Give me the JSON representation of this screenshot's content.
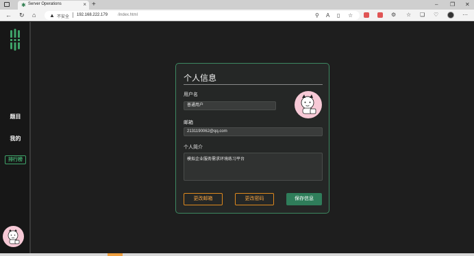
{
  "browser": {
    "tab_title": "Server Operations",
    "url_warning": "不安全",
    "url_host": "192.168.222.179",
    "url_path": "/index.html"
  },
  "sidebar": {
    "items": [
      {
        "label": "题目"
      },
      {
        "label": "我的"
      },
      {
        "label": "排行榜"
      }
    ]
  },
  "profile": {
    "title": "个人信息",
    "username_label": "用户名",
    "username_value": "普通用户",
    "email_label": "邮箱",
    "email_value": "2131190062@qq.com",
    "bio_label": "个人简介",
    "bio_value": "模拟企业服务需求环境练习平台",
    "change_email_button": "更改邮箱",
    "change_password_button": "更改密码",
    "save_button": "保存信息"
  },
  "colors": {
    "accent": "#3fa46a",
    "outline_button": "#e08a1e",
    "save_button": "#2f7d5a",
    "avatar_bg": "#f7c9d6"
  }
}
